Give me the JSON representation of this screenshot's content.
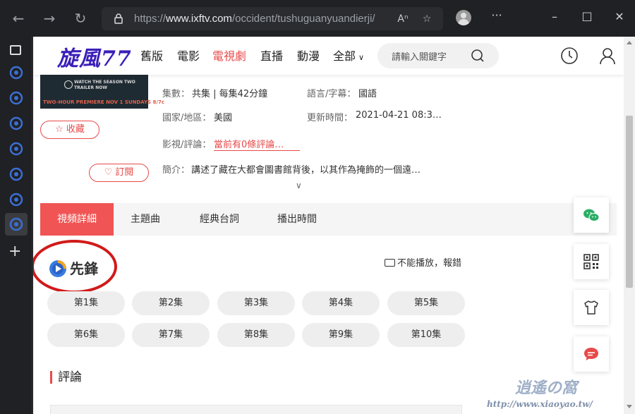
{
  "browser": {
    "url_prefix": "https://",
    "url_domain": "www.ixftv.com",
    "url_path": "/occident/tushuguanyuandierji/"
  },
  "site": {
    "logo": "旋風77",
    "menu": [
      "舊版",
      "電影",
      "電視劇",
      "直播",
      "動漫",
      "全部"
    ],
    "active_menu": "電視劇",
    "search_placeholder": "請輸入關鍵字"
  },
  "poster": {
    "line1": "WATCH THE SEASON TWO",
    "line2": "TRAILER NOW",
    "line3": "TWO-HOUR PREMIERE NOV 1    SUNDAYS 8/7c"
  },
  "actions": {
    "favorite": "收藏",
    "subscribe": "訂閱"
  },
  "info": {
    "episodes_label": "集數：",
    "episodes_value": "共集 | 每集42分鐘",
    "language_label": "語言/字幕：",
    "language_value": "國語",
    "region_label": "國家/地區：",
    "region_value": "美國",
    "updated_label": "更新時間：",
    "updated_value": "2021-04-21 08:3…",
    "review_label": "影視/評論：",
    "review_value": "當前有0條評論…",
    "intro_label": "簡介：",
    "intro_value": "講述了藏在大都會圖書館背後，以其作為掩飾的一個遠…"
  },
  "tabs": [
    "視頻詳細",
    "主題曲",
    "經典台詞",
    "播出時間"
  ],
  "source_name": "先鋒",
  "report_text": "不能播放，報錯",
  "episodes": [
    "第1集",
    "第2集",
    "第3集",
    "第4集",
    "第5集",
    "第6集",
    "第7集",
    "第8集",
    "第9集",
    "第10集"
  ],
  "comments_title": "評論",
  "watermark": {
    "text1": "逍遙の窩",
    "text2": "http://www.xiaoyao.tw/"
  }
}
